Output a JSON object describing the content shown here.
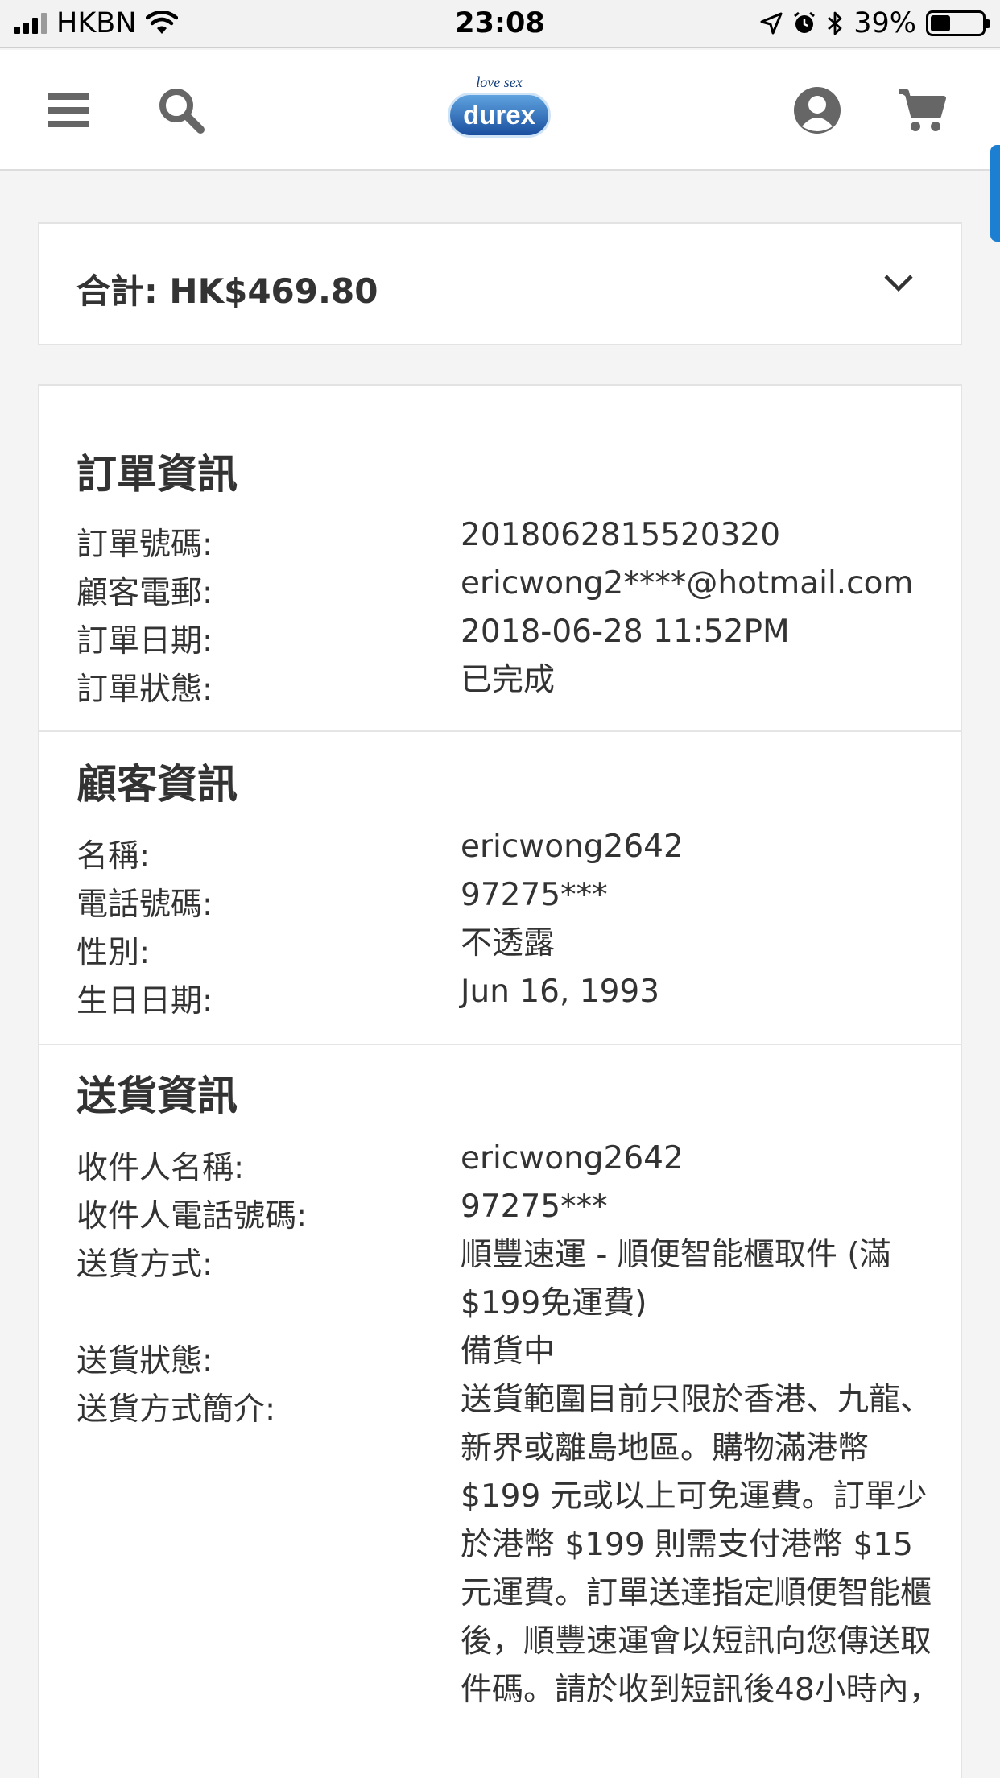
{
  "status_bar": {
    "carrier": "HKBN",
    "time": "23:08",
    "battery": "39%",
    "battery_level": 0.39
  },
  "header": {
    "menu_icon": "hamburger-icon",
    "search_icon": "search-icon",
    "logo_tagline": "love sex",
    "logo_brand": "durex",
    "account_icon": "user-icon",
    "cart_icon": "cart-icon"
  },
  "total": {
    "text": "合計: HK$469.80"
  },
  "order_info": {
    "title": "訂單資訊",
    "rows": [
      {
        "label": "訂單號碼:",
        "value": "2018062815520320"
      },
      {
        "label": "顧客電郵:",
        "value": "ericwong2****@hotmail.com"
      },
      {
        "label": "訂單日期:",
        "value": "2018-06-28 11:52PM"
      },
      {
        "label": "訂單狀態:",
        "value": "已完成"
      }
    ]
  },
  "customer_info": {
    "title": "顧客資訊",
    "rows": [
      {
        "label": "名稱:",
        "value": "ericwong2642"
      },
      {
        "label": "電話號碼:",
        "value": "97275***"
      },
      {
        "label": "性別:",
        "value": "不透露"
      },
      {
        "label": "生日日期:",
        "value": "Jun 16, 1993"
      }
    ]
  },
  "delivery_info": {
    "title": "送貨資訊",
    "rows": [
      {
        "label": "收件人名稱:",
        "value": "ericwong2642"
      },
      {
        "label": "收件人電話號碼:",
        "value": "97275***"
      },
      {
        "label": "送貨方式:",
        "value": "順豐速運 - 順便智能櫃取件 (滿$199免運費)"
      },
      {
        "label": "送貨狀態:",
        "value": "備貨中"
      },
      {
        "label": "送貨方式簡介:",
        "value": "送貨範圍目前只限於香港、九龍、新界或離島地區。購物滿港幣 $199 元或以上可免運費。訂單少於港幣 $199 則需支付港幣 $15 元運費。訂單送達指定順便智能櫃後，順豐速運會以短訊向您傳送取件碼。請於收到短訊後48小時內，"
      }
    ]
  }
}
